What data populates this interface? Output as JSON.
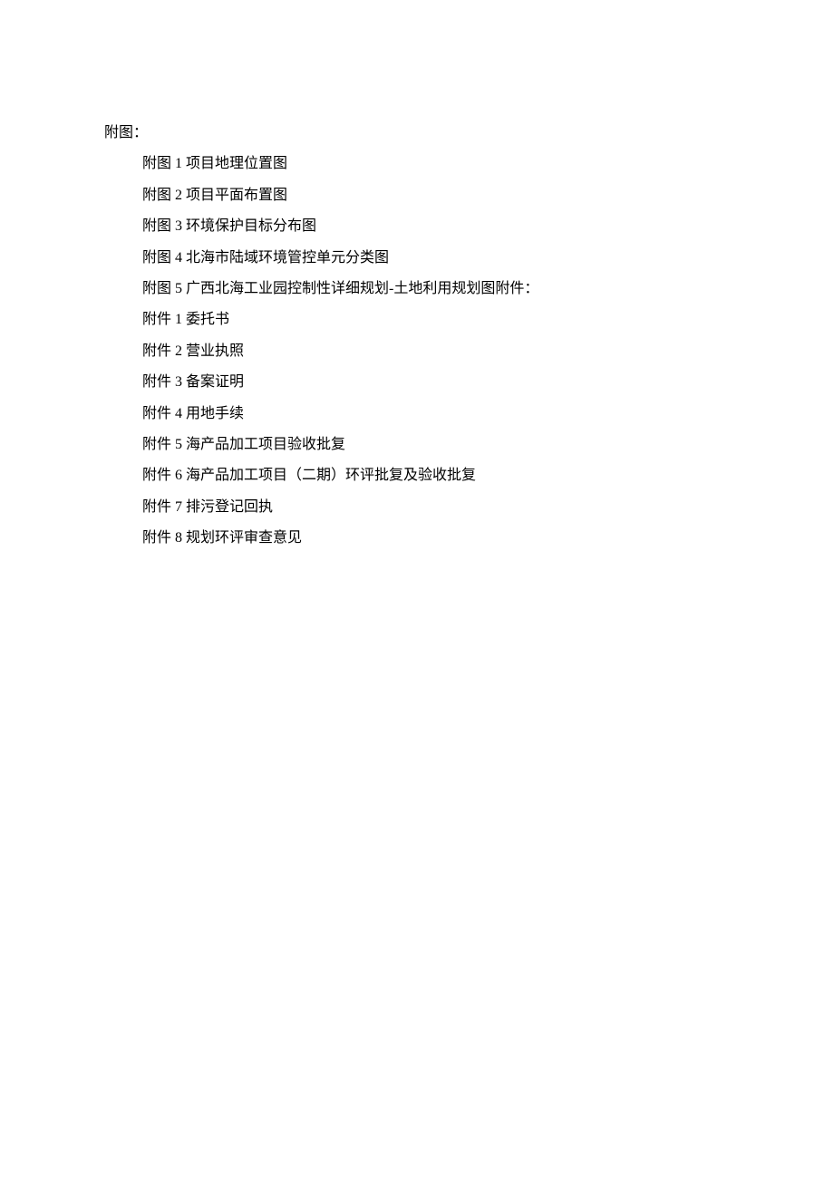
{
  "figures": {
    "header": "附图：",
    "items": [
      "附图 1 项目地理位置图",
      "附图 2 项目平面布置图",
      "附图 3 环境保护目标分布图",
      "附图 4 北海市陆域环境管控单元分类图",
      "附图 5 广西北海工业园控制性详细规划-土地利用规划图附件："
    ]
  },
  "attachments": {
    "items": [
      "附件 1 委托书",
      "附件 2 营业执照",
      "附件 3 备案证明",
      "附件 4 用地手续",
      "附件 5 海产品加工项目验收批复",
      "附件 6 海产品加工项目（二期）环评批复及验收批复",
      "附件 7 排污登记回执",
      "附件 8 规划环评审查意见"
    ]
  }
}
